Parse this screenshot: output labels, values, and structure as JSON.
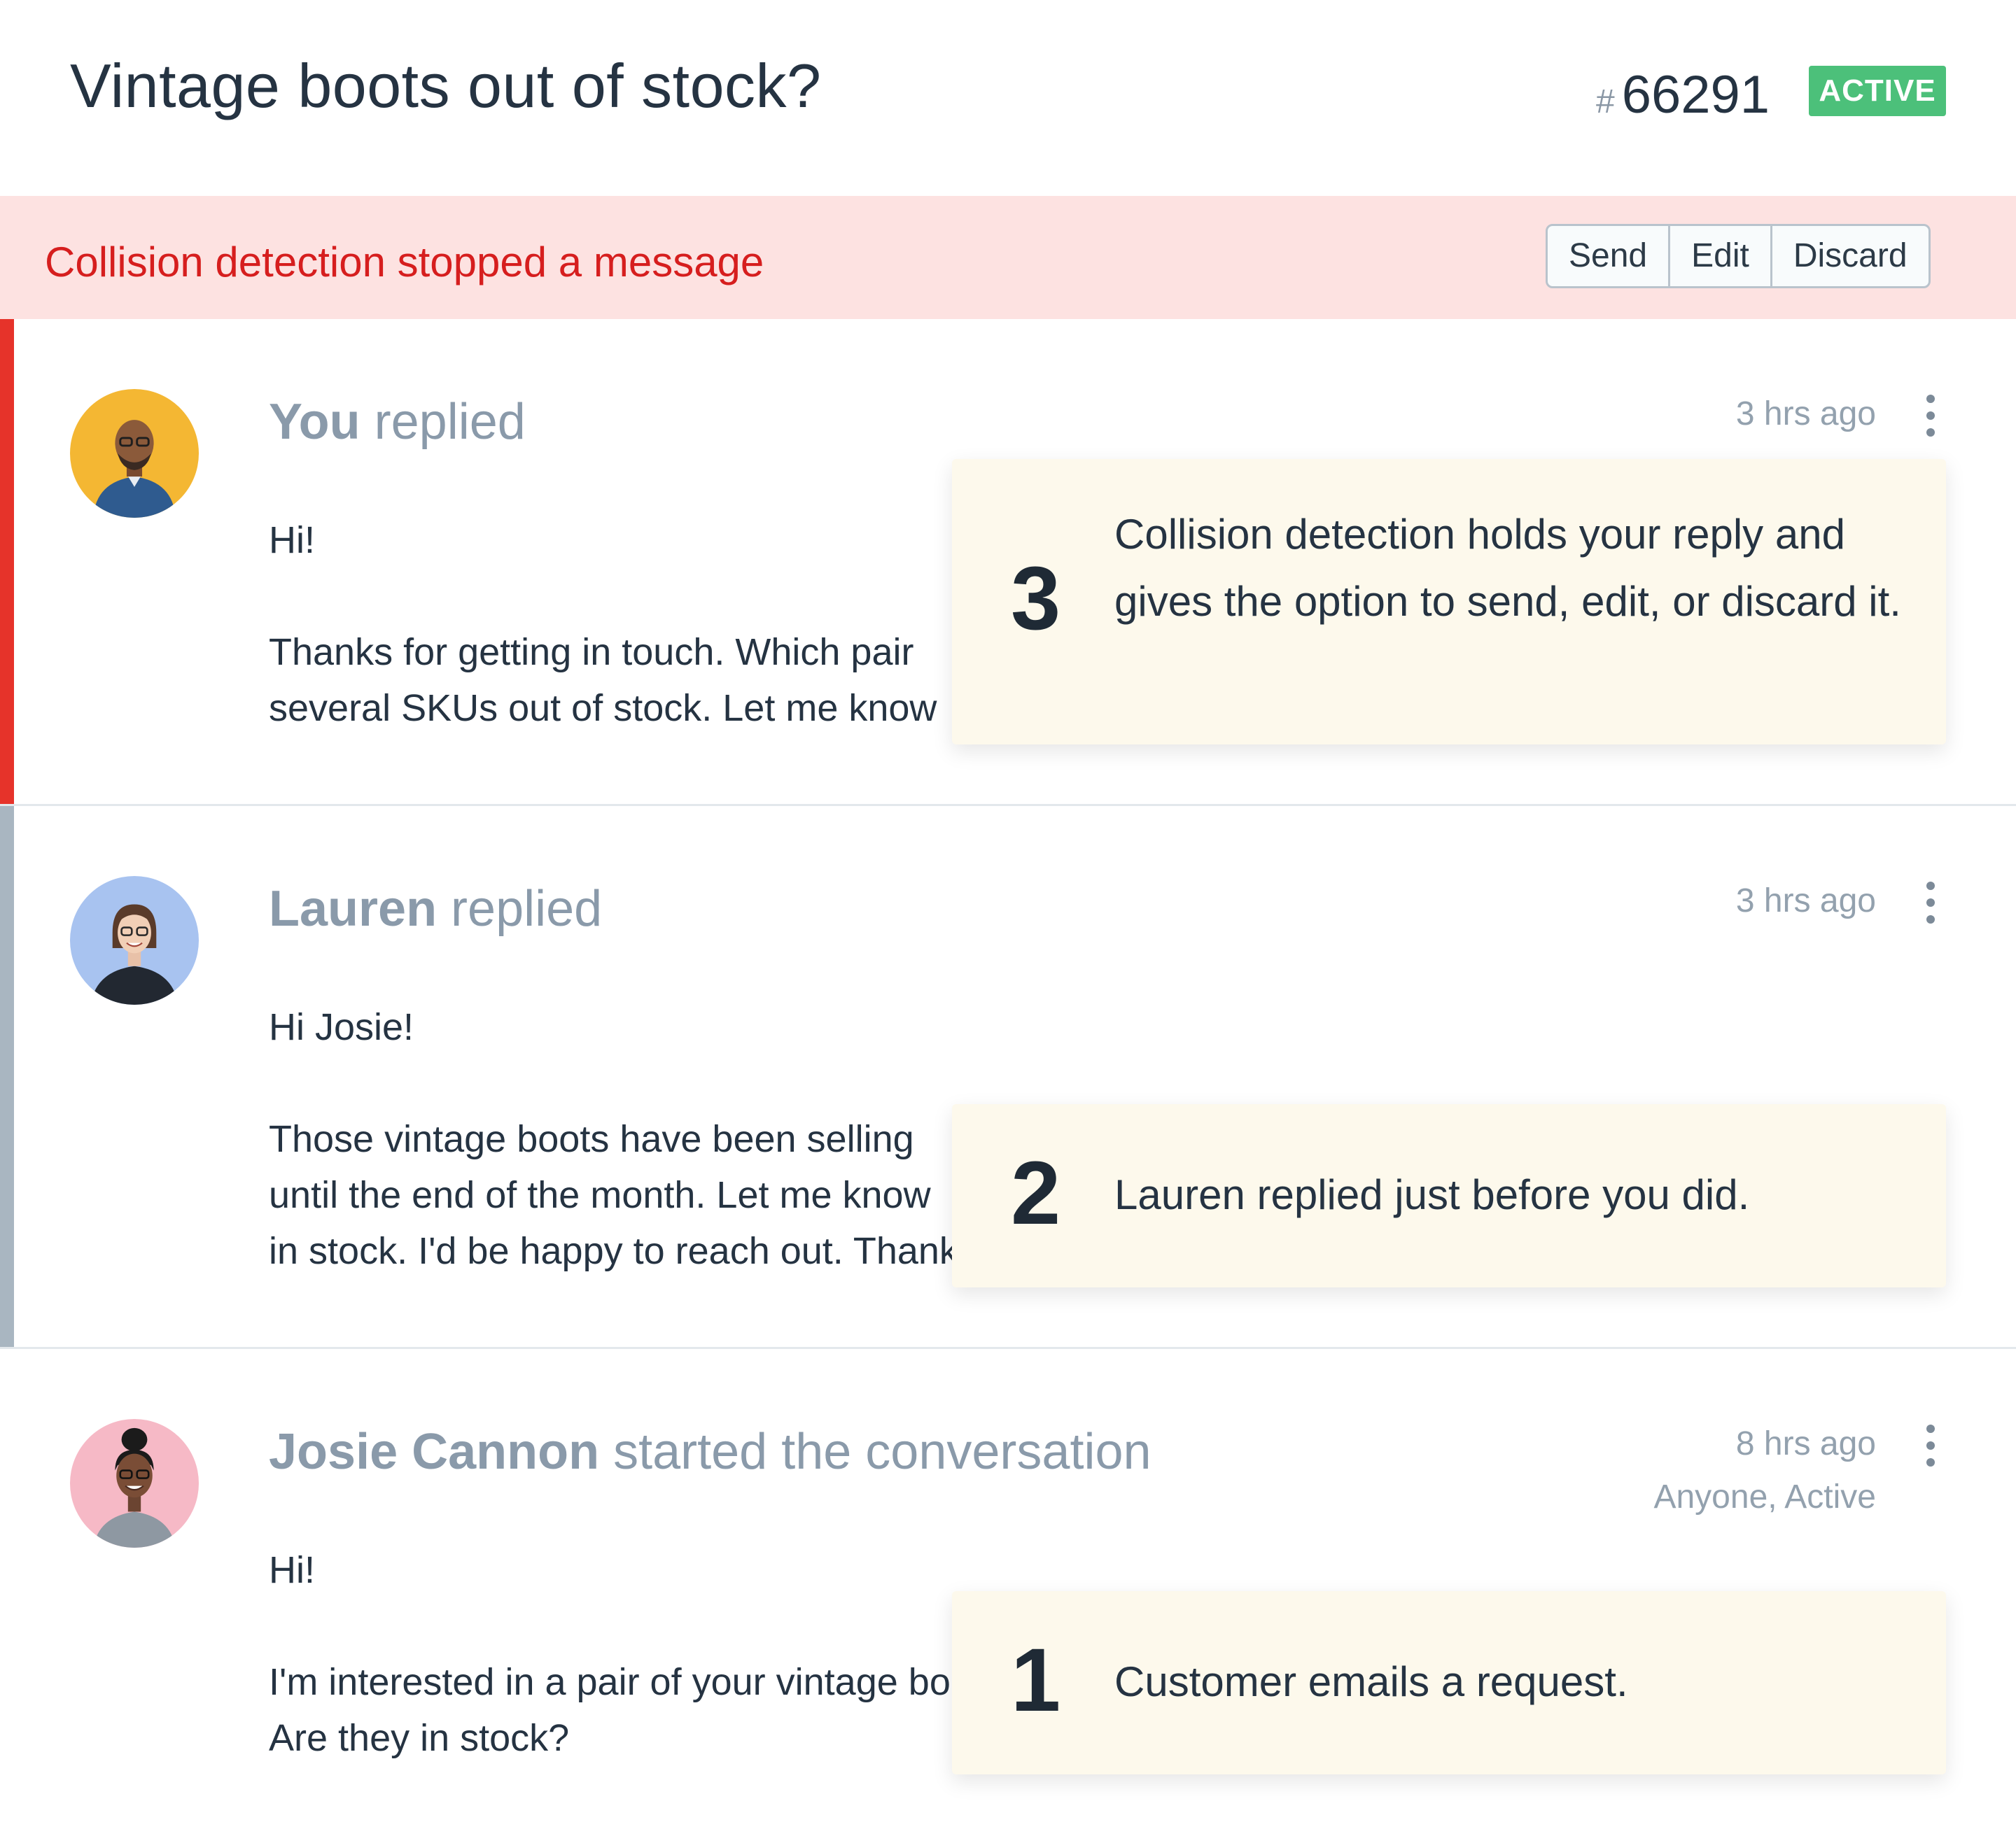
{
  "header": {
    "title": "Vintage boots out of stock?",
    "ticket_hash": "#",
    "ticket_number": "66291",
    "status": "ACTIVE"
  },
  "colors": {
    "status_green": "#4cc07a",
    "collision_red": "#d61e1e",
    "collision_bg": "#fde2e1",
    "accent_red": "#e6332a",
    "accent_gray": "#a9b6c1",
    "callout_bg": "#fdf9ec"
  },
  "collision": {
    "message": "Collision detection stopped a message",
    "buttons": [
      "Send",
      "Edit",
      "Discard"
    ]
  },
  "threads": [
    {
      "name": "You",
      "action": " replied",
      "time": "3 hrs ago",
      "meta": "",
      "greeting": "Hi!",
      "body_lines": [
        "Thanks for getting in touch. Which pair",
        "several SKUs out of stock. Let me know"
      ]
    },
    {
      "name": "Lauren",
      "action": " replied",
      "time": "3 hrs ago",
      "meta": "",
      "greeting": "Hi Josie!",
      "body_lines": [
        "Those vintage boots have been selling",
        "until the end of the month. Let me know",
        "in stock. I'd be happy to reach out. Thanks"
      ]
    },
    {
      "name": "Josie Cannon",
      "action": " started the conversation",
      "time": "8 hrs ago",
      "meta": "Anyone, Active",
      "greeting": "Hi!",
      "body_lines": [
        "I'm interested in a pair of your vintage boots.",
        "Are they in stock?"
      ]
    }
  ],
  "callouts": [
    {
      "number": "3",
      "text": "Collision detection holds your reply and gives the option to send, edit, or discard it."
    },
    {
      "number": "2",
      "text": "Lauren replied just before you did."
    },
    {
      "number": "1",
      "text": "Customer emails a request."
    }
  ],
  "icons": {
    "more": "more-vertical-icon"
  }
}
